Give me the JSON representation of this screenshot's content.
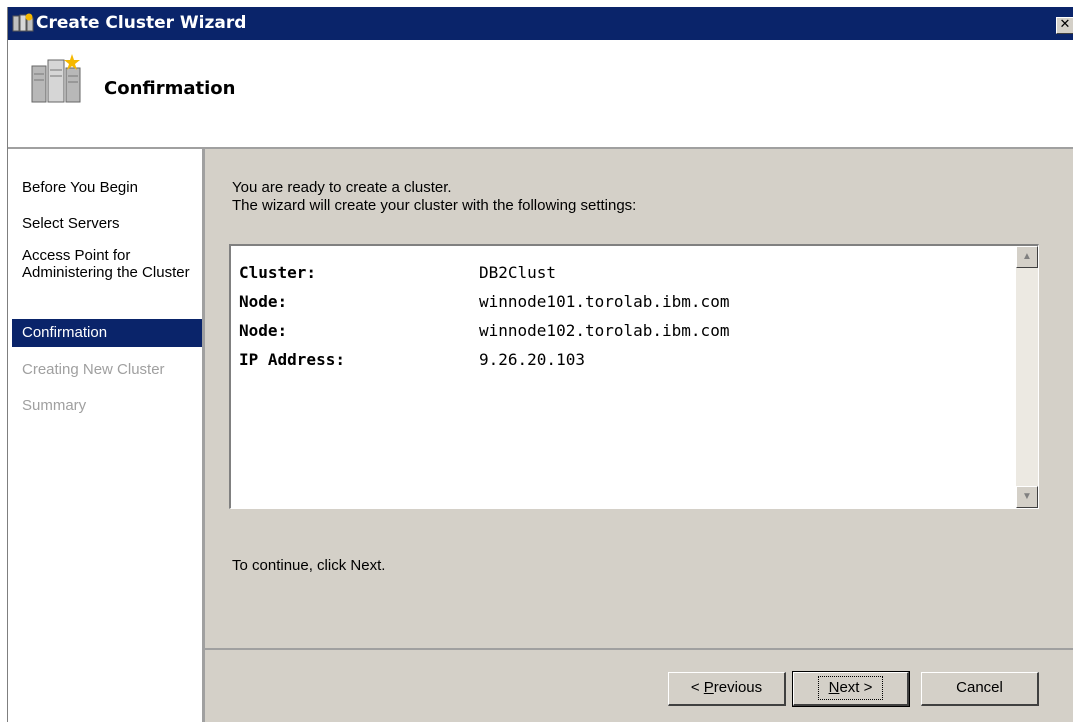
{
  "window": {
    "title": "Create Cluster Wizard",
    "close_glyph": "✕"
  },
  "header": {
    "title": "Confirmation",
    "icon": "cluster-servers-icon"
  },
  "nav": {
    "items": [
      {
        "label": "Before You Begin",
        "state": "normal"
      },
      {
        "label": "Select Servers",
        "state": "normal"
      },
      {
        "label": "Access Point for Administering the Cluster",
        "state": "normal"
      },
      {
        "label": "Confirmation",
        "state": "selected"
      },
      {
        "label": "Creating New Cluster",
        "state": "disabled"
      },
      {
        "label": "Summary",
        "state": "disabled"
      }
    ]
  },
  "content": {
    "intro_line1": "You are ready to create a cluster.",
    "intro_line2": "The wizard will create your cluster with the following settings:",
    "settings": [
      {
        "key": "Cluster:",
        "value": "DB2Clust"
      },
      {
        "key": "Node:",
        "value": "winnode101.torolab.ibm.com"
      },
      {
        "key": "Node:",
        "value": "winnode102.torolab.ibm.com"
      },
      {
        "key": "IP Address:",
        "value": "9.26.20.103"
      }
    ],
    "continue_text": "To continue, click Next."
  },
  "buttons": {
    "previous_prefix": "< ",
    "previous_accel": "P",
    "previous_rest": "revious",
    "next_accel": "N",
    "next_rest": "ext >",
    "cancel": "Cancel"
  },
  "colors": {
    "titlebar": "#0a246a",
    "selected": "#0a246a",
    "face": "#d4d0c8",
    "disabled_text": "#a0a0a0"
  }
}
